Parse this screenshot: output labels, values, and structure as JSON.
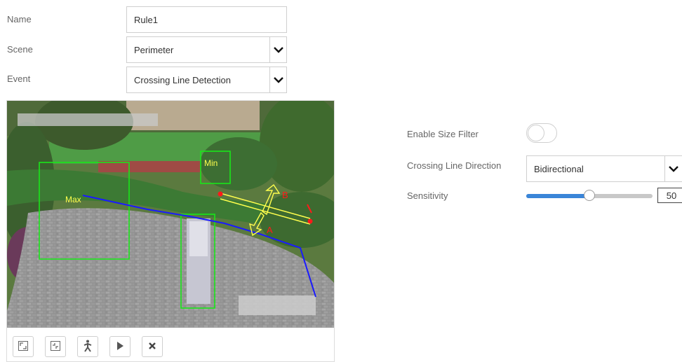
{
  "form": {
    "name_label": "Name",
    "name_value": "Rule1",
    "scene_label": "Scene",
    "scene_value": "Perimeter",
    "event_label": "Event",
    "event_value": "Crossing Line Detection"
  },
  "video": {
    "overlay": {
      "min_label": "Min",
      "max_label": "Max",
      "line_label_a": "A",
      "line_label_b": "B"
    },
    "colors": {
      "box": "#19e619",
      "line": "#1a1aff",
      "arrow": "#ffff4d",
      "point": "#ff1a1a"
    }
  },
  "toolbar": {
    "buttons": [
      {
        "name": "fullscreen-icon"
      },
      {
        "name": "exit-fullscreen-icon"
      },
      {
        "name": "person-icon"
      },
      {
        "name": "play-icon"
      },
      {
        "name": "close-icon"
      }
    ]
  },
  "settings": {
    "size_filter_label": "Enable Size Filter",
    "size_filter_enabled": false,
    "direction_label": "Crossing Line Direction",
    "direction_value": "Bidirectional",
    "sensitivity_label": "Sensitivity",
    "sensitivity_value": "50",
    "sensitivity_fraction": 0.5
  }
}
